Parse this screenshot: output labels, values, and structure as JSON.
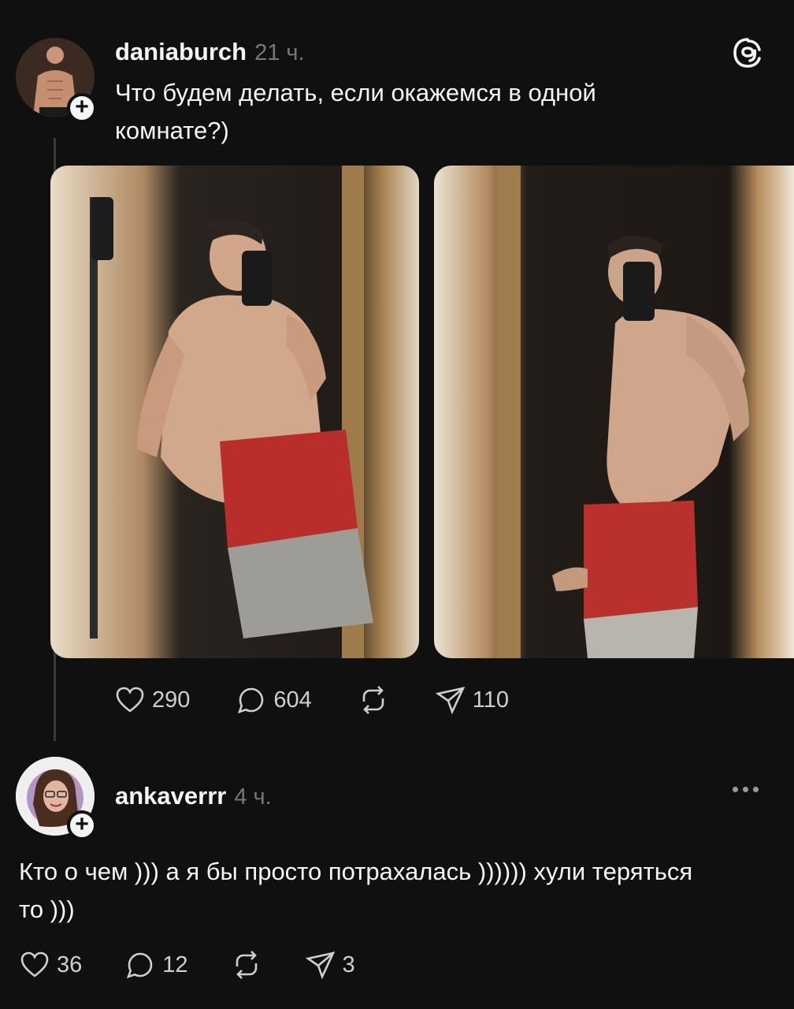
{
  "post": {
    "username": "daniaburch",
    "time": "21 ч.",
    "text": "Что будем делать, если окажемся в одной комнате?)",
    "actions": {
      "likes": "290",
      "comments": "604",
      "shares": "110"
    },
    "photos": [
      {
        "name": "mirror-selfie-left"
      },
      {
        "name": "mirror-selfie-right"
      }
    ]
  },
  "reply": {
    "username": "ankaverrr",
    "time": "4 ч.",
    "text": "Кто о чем ))) а я бы просто потрахалась )))))) хули теряться то )))",
    "actions": {
      "likes": "36",
      "comments": "12",
      "shares": "3"
    }
  },
  "icons": {
    "app": "threads-logo-icon",
    "like": "heart-icon",
    "comment": "comment-icon",
    "repost": "repost-icon",
    "share": "send-icon",
    "more": "more-options-icon"
  },
  "colors": {
    "background": "#101010",
    "text": "#f3f5f7",
    "muted": "#777777"
  }
}
